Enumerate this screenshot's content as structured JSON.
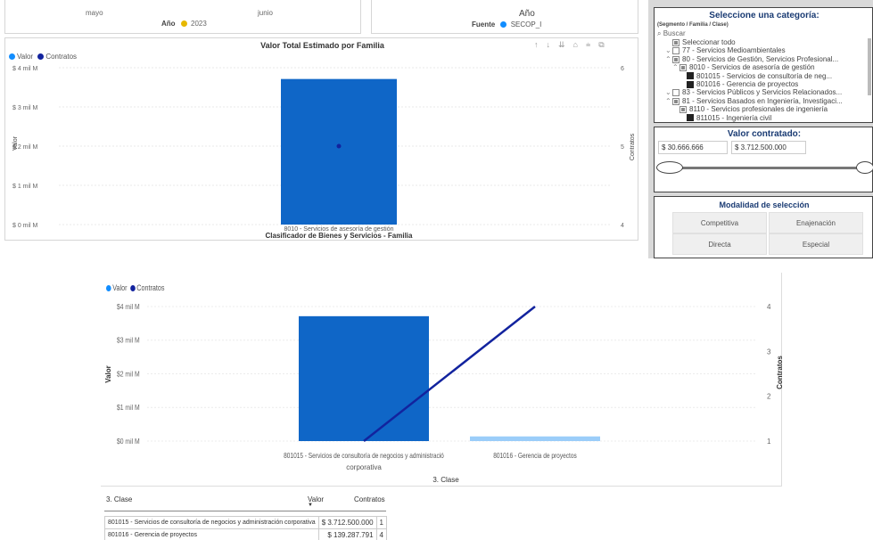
{
  "top_left": {
    "months": [
      "mayo",
      "junio"
    ],
    "year_label": "Año",
    "year_value": "2023",
    "year_dot_color": "#e6b800"
  },
  "top_right": {
    "title": "Año",
    "source_label": "Fuente",
    "source_value": "SECOP_I",
    "source_dot_color": "#118dff"
  },
  "main_chart": {
    "title": "Valor Total Estimado por Familia",
    "legend": [
      {
        "name": "Valor",
        "color": "#118dff"
      },
      {
        "name": "Contratos",
        "color": "#12239e"
      }
    ],
    "toolbar_icons": [
      "arrow-up-icon",
      "arrow-down-icon",
      "expand-all-icon",
      "hierarchy-icon",
      "filter-icon",
      "focus-mode-icon"
    ],
    "chart_data": {
      "type": "bar",
      "categories": [
        "8010 - Servicios de asesoría de gestión"
      ],
      "series": [
        {
          "name": "Valor",
          "values": [
            3712500000
          ]
        },
        {
          "name": "Contratos",
          "values": [
            5
          ]
        }
      ],
      "y_tick_labels": [
        "$ 4 mil M",
        "$ 3 mil M",
        "$ 2 mil M",
        "$ 1 mil M",
        "$ 0 mil M"
      ],
      "ylim": [
        0,
        4000000000
      ],
      "y2_tick_labels": [
        "6",
        "5",
        "4"
      ],
      "y2lim": [
        4,
        6
      ],
      "ylabel": "Valor",
      "y2label": "Contratos",
      "xlabel": "Clasificador de Bienes y Servicios - Familia",
      "bar_color": "#0f66c7",
      "dot_color": "#12239e"
    }
  },
  "category_panel": {
    "title": "Seleccione una categoría:",
    "subtitle": "(Segmento / Familia / Clase)",
    "search_placeholder": "Buscar",
    "items": [
      {
        "level": 0,
        "chev": "",
        "state": "partial",
        "label": "Seleccionar todo"
      },
      {
        "level": 0,
        "chev": "⌄",
        "state": "empty",
        "label": "77 - Servicios Medioambientales"
      },
      {
        "level": 0,
        "chev": "⌃",
        "state": "partial",
        "label": "80 - Servicios de Gestión, Servicios Profesional..."
      },
      {
        "level": 1,
        "chev": "⌃",
        "state": "partial",
        "label": "8010 - Servicios de asesoría de gestión"
      },
      {
        "level": 2,
        "chev": "",
        "state": "checked",
        "label": "801015 - Servicios de consultoría de neg..."
      },
      {
        "level": 2,
        "chev": "",
        "state": "checked",
        "label": "801016 - Gerencia de proyectos"
      },
      {
        "level": 0,
        "chev": "⌄",
        "state": "empty",
        "label": "83 - Servicios Públicos y Servicios Relacionados..."
      },
      {
        "level": 0,
        "chev": "⌃",
        "state": "partial",
        "label": "81 - Servicios Basados en Ingeniería, Investigaci..."
      },
      {
        "level": 1,
        "chev": "",
        "state": "partial",
        "label": "8110 - Servicios profesionales de ingeniería"
      },
      {
        "level": 2,
        "chev": "",
        "state": "checked",
        "label": "811015 - Ingeniería civil"
      }
    ]
  },
  "value_panel": {
    "title": "Valor contratado:",
    "min_value": "$ 30.666.666",
    "max_value": "$ 3.712.500.000"
  },
  "modality_panel": {
    "title": "Modalidad de selección",
    "buttons": [
      "Competitiva",
      "Enajenación",
      "Directa",
      "Especial"
    ]
  },
  "bottom_chart": {
    "legend": [
      {
        "name": "Valor",
        "color": "#118dff"
      },
      {
        "name": "Contratos",
        "color": "#12239e"
      }
    ],
    "chart_data": {
      "type": "bar",
      "categories": [
        "801015 - Servicios de consultoría de negocios y administración corporativa",
        "801016 - Gerencia de proyectos"
      ],
      "series": [
        {
          "name": "Valor",
          "values": [
            3712500000,
            139287791
          ]
        },
        {
          "name": "Contratos",
          "values": [
            1,
            4
          ]
        }
      ],
      "bar_colors": [
        "#0f66c7",
        "#9bcdf9"
      ],
      "line_color": "#12239e",
      "y_tick_labels": [
        "$4 mil M",
        "$3 mil M",
        "$2 mil M",
        "$1 mil M",
        "$0 mil M"
      ],
      "ylim": [
        0,
        4000000000
      ],
      "y2_tick_labels": [
        "4",
        "3",
        "2",
        "1"
      ],
      "y2lim": [
        1,
        4
      ],
      "ylabel": "Valor",
      "y2label": "Contratos",
      "xlabel": "3. Clase"
    }
  },
  "table": {
    "headers": [
      "3. Clase",
      "Valor",
      "Contratos"
    ],
    "sort_indicator": "▼",
    "rows": [
      [
        "801015 - Servicios de consultoría de negocios y administración corporativa",
        "$ 3.712.500.000",
        "1"
      ],
      [
        "801016 - Gerencia de proyectos",
        "$ 139.287.791",
        "4"
      ]
    ]
  }
}
